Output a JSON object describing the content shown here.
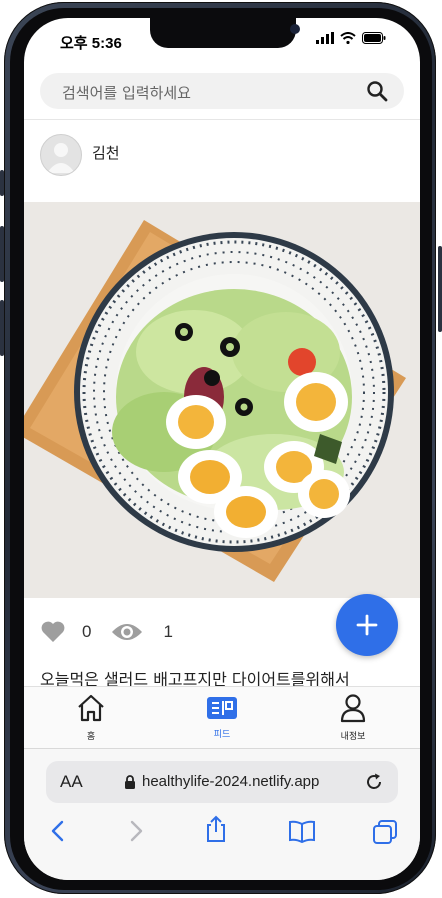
{
  "status_bar": {
    "time": "오후 5:36"
  },
  "search": {
    "placeholder": "검색어를 입력하세요"
  },
  "post": {
    "author": "김천",
    "likes": "0",
    "views": "1",
    "caption": "오늘먹은 샐러드 배고프지만 다이어트를위해서"
  },
  "bottom_nav": {
    "items": [
      {
        "label": "홈",
        "icon": "home-icon"
      },
      {
        "label": "피드",
        "icon": "feed-icon",
        "active": true
      },
      {
        "label": "내정보",
        "icon": "profile-icon"
      }
    ]
  },
  "browser": {
    "text_size_label": "AA",
    "url": "healthylife-2024.netlify.app"
  },
  "colors": {
    "accent": "#2f6fe8",
    "phone_frame": "#2a3140"
  }
}
